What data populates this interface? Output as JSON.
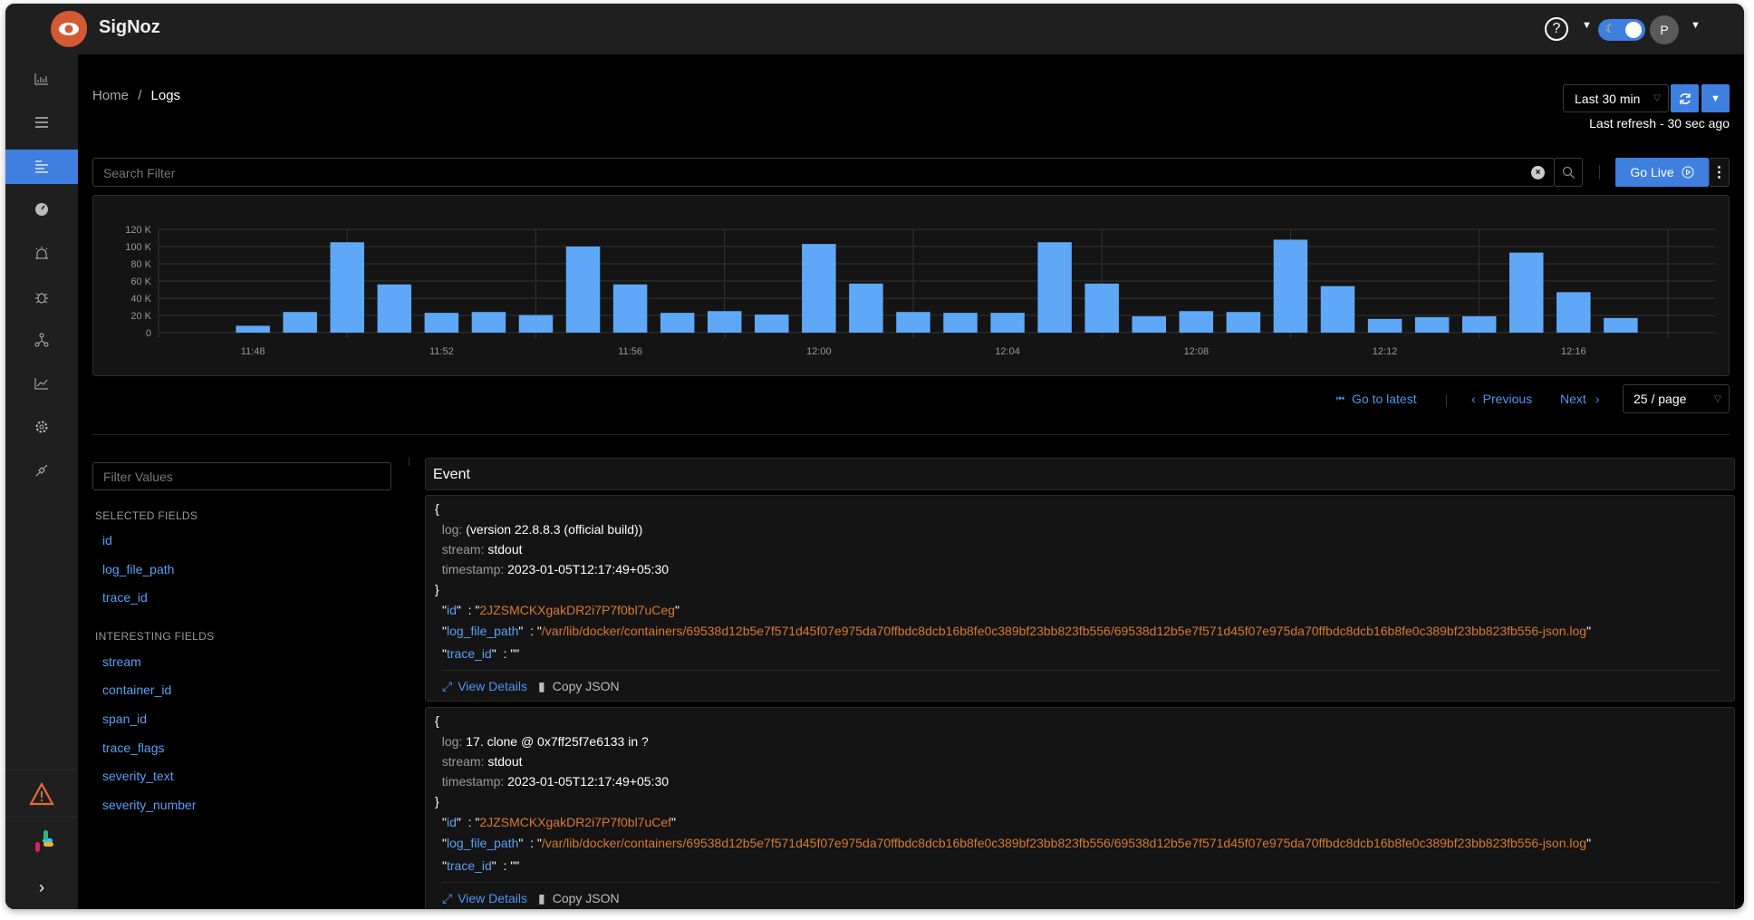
{
  "app": {
    "name": "SigNoz"
  },
  "header": {
    "avatar_initial": "P"
  },
  "breadcrumb": {
    "home": "Home",
    "separator": "/",
    "current": "Logs"
  },
  "time_picker": {
    "selected": "Last 30 min",
    "last_refresh": "Last refresh - 30 sec ago"
  },
  "search": {
    "placeholder": "Search Filter",
    "go_live": "Go Live"
  },
  "pagination": {
    "go_to_latest": "Go to latest",
    "previous": "Previous",
    "next": "Next",
    "page_size": "25 / page"
  },
  "filters": {
    "placeholder": "Filter Values",
    "selected_header": "SELECTED FIELDS",
    "selected": [
      "id",
      "log_file_path",
      "trace_id"
    ],
    "interesting_header": "INTERESTING FIELDS",
    "interesting": [
      "stream",
      "container_id",
      "span_id",
      "trace_flags",
      "severity_text",
      "severity_number"
    ]
  },
  "events": {
    "header": "Event",
    "view_details": "View Details",
    "copy_json": "Copy JSON",
    "items": [
      {
        "log": "(version 22.8.8.3 (official build))",
        "stream": "stdout",
        "timestamp": "2023-01-05T12:17:49+05:30",
        "id": "2JZSMCKXgakDR2i7P7f0bl7uCeg",
        "log_file_path": "/var/lib/docker/containers/69538d12b5e7f571d45f07e975da70ffbdc8dcb16b8fe0c389bf23bb823fb556/69538d12b5e7f571d45f07e975da70ffbdc8dcb16b8fe0c389bf23bb823fb556-json.log",
        "trace_id": ""
      },
      {
        "log": "17. clone @ 0x7ff25f7e6133 in ?",
        "stream": "stdout",
        "timestamp": "2023-01-05T12:17:49+05:30",
        "id": "2JZSMCKXgakDR2i7P7f0bl7uCef",
        "log_file_path": "/var/lib/docker/containers/69538d12b5e7f571d45f07e975da70ffbdc8dcb16b8fe0c389bf23bb823fb556/69538d12b5e7f571d45f07e975da70ffbdc8dcb16b8fe0c389bf23bb823fb556-json.log",
        "trace_id": ""
      }
    ]
  },
  "colors": {
    "accent": "#3e7fe0",
    "bar": "#5ea8f7",
    "string": "#d77a2f",
    "key": "#5aa0f2"
  },
  "chart_data": {
    "type": "bar",
    "title": "",
    "xlabel": "",
    "ylabel": "",
    "x_start_minute": "11:48",
    "x_step_minutes": 1,
    "values": [
      8000,
      24000,
      105000,
      56000,
      23000,
      24000,
      20500,
      100000,
      56000,
      23000,
      25000,
      21000,
      103000,
      57000,
      24000,
      23000,
      23000,
      105000,
      57000,
      19000,
      25000,
      24000,
      108000,
      54000,
      16000,
      18000,
      19000,
      93000,
      47000,
      17000
    ],
    "ylim": [
      0,
      120000
    ],
    "yticks": [
      "0",
      "20 K",
      "40 K",
      "60 K",
      "80 K",
      "100 K",
      "120 K"
    ],
    "xticks": [
      "11:48",
      "11:52",
      "11:56",
      "12:00",
      "12:04",
      "12:08",
      "12:12",
      "12:16"
    ],
    "grid": true
  }
}
